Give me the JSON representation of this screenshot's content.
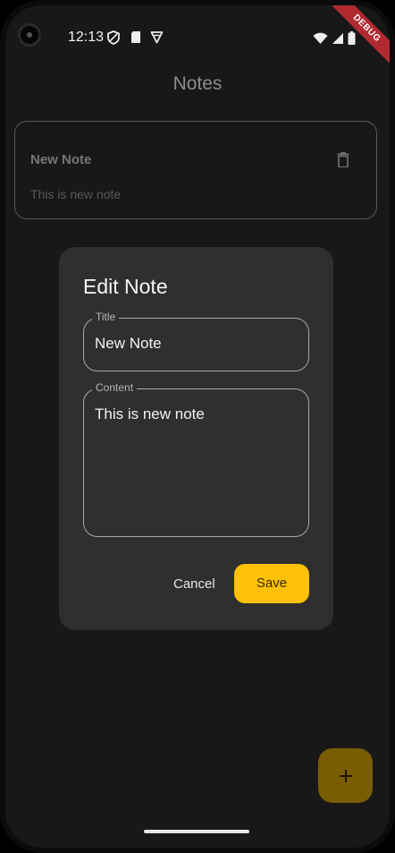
{
  "status_bar": {
    "time": "12:13",
    "icons": [
      "shield-icon",
      "sd-card-icon",
      "vpn-icon",
      "wifi-icon",
      "signal-icon",
      "battery-icon"
    ]
  },
  "debug_banner": "DEBUG",
  "app_bar": {
    "title": "Notes"
  },
  "notes": [
    {
      "title": "New Note",
      "content": "This is new note"
    }
  ],
  "dialog": {
    "title": "Edit Note",
    "title_field": {
      "label": "Title",
      "value": "New Note"
    },
    "content_field": {
      "label": "Content",
      "value": "This is new note"
    },
    "cancel_label": "Cancel",
    "save_label": "Save"
  },
  "fab": {
    "icon": "plus-icon"
  },
  "colors": {
    "background": "#181818",
    "dialog": "#2f2f2f",
    "accent": "#ffc107",
    "fab_dimmed": "#7a5c04",
    "debug_ribbon": "#b02a30"
  }
}
